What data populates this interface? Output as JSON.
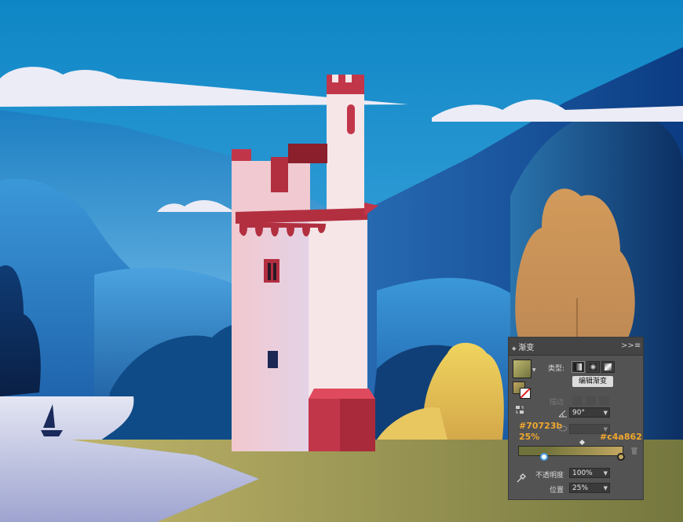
{
  "gradient_panel": {
    "tab_title": "渐变",
    "expand_label": ">>",
    "menu_label": "≡",
    "type_label": "类型:",
    "type_options_icons": [
      "linear-gradient-icon",
      "radial-gradient-icon",
      "freeform-gradient-icon"
    ],
    "edit_gradient_label": "编辑渐变",
    "stroke_label": "描边",
    "angle_value": "90°",
    "aspect_value": "",
    "start_color_hex": "#70723b",
    "start_location_pct": "25%",
    "end_color_hex": "#c4a862",
    "opacity_label": "不透明度",
    "opacity_value": "100%",
    "location_label": "位置",
    "location_value": "25%",
    "gradient_start_fraction": 0.25,
    "colors": {
      "start": "#70723b",
      "end": "#c4a862",
      "annotation": "#f0a830"
    }
  }
}
